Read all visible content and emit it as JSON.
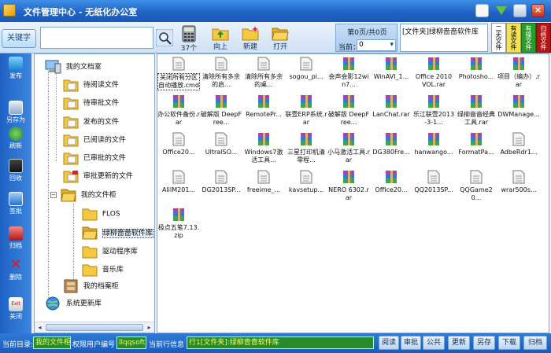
{
  "window": {
    "title": "文件管理中心 - 无纸化办公室"
  },
  "toolbar": {
    "keyword_label": "关键字",
    "search_value": "",
    "items": [
      {
        "label": "37个",
        "icon": "calculator-icon"
      },
      {
        "label": "向上",
        "icon": "folder-up-icon"
      },
      {
        "label": "新建",
        "icon": "new-folder-icon"
      },
      {
        "label": "打开",
        "icon": "open-folder-icon"
      }
    ],
    "page_info": "第0页/共0页",
    "current_label": "当前：",
    "current_page": "0",
    "path": "[文件夹]绿柳啬啬软件库",
    "tabs": [
      "二无文件",
      "有读文件",
      "有操文件",
      "归档文件"
    ]
  },
  "sidebar": {
    "items": [
      {
        "label": "发布",
        "icon": "publish-icon"
      },
      {
        "label": "另存为",
        "icon": "save-as-icon"
      },
      {
        "label": "刷新",
        "icon": "refresh-icon"
      },
      {
        "label": "回收",
        "icon": "recycle-icon"
      },
      {
        "label": "签批",
        "icon": "sign-icon"
      },
      {
        "label": "归档",
        "icon": "archive-icon"
      },
      {
        "label": "删除",
        "icon": "delete-icon"
      },
      {
        "label": "关闭",
        "icon": "exit-icon"
      }
    ]
  },
  "tree": {
    "root": "我的文档室",
    "children": [
      "待阅读文件",
      "待审批文件",
      "发布的文件",
      "已阅读的文件",
      "已审批的文件",
      "审批更新的文件"
    ],
    "cabinet": "我的文件柜",
    "cabinet_children": [
      "FLOS",
      "绿柳啬啬软件库",
      "驱动程序库",
      "音乐库"
    ],
    "archive": "我的档案柜",
    "update": "系统更新库"
  },
  "files": [
    {
      "name": "关闭所有分区自动播放.cmd",
      "type": "doc"
    },
    {
      "name": "清除所有多余的启...",
      "type": "doc"
    },
    {
      "name": "清除所有多余的桌...",
      "type": "doc"
    },
    {
      "name": "sogou_pi...",
      "type": "doc"
    },
    {
      "name": "会声会影12win7...",
      "type": "rar"
    },
    {
      "name": "WinAVI_1...",
      "type": "rar"
    },
    {
      "name": "Office 2010 VOL.rar",
      "type": "rar"
    },
    {
      "name": "Photosho...",
      "type": "rar"
    },
    {
      "name": "项目（编办）.rar",
      "type": "rar"
    },
    {
      "name": "办公软件备份.rar",
      "type": "rar"
    },
    {
      "name": "破解版 DeepFree...",
      "type": "rar"
    },
    {
      "name": "RemotePr...",
      "type": "rar"
    },
    {
      "name": "联壹ERP系统.rar",
      "type": "rar"
    },
    {
      "name": "破解版 DeepFree...",
      "type": "rar"
    },
    {
      "name": "LanChat.rar",
      "type": "rar"
    },
    {
      "name": "乐江联壹2013-3-1...",
      "type": "rar"
    },
    {
      "name": "绿柳啬啬经典工具.rar",
      "type": "rar"
    },
    {
      "name": "DWManage...",
      "type": "rar"
    },
    {
      "name": "Office20...",
      "type": "doc"
    },
    {
      "name": "UltraISO...",
      "type": "doc"
    },
    {
      "name": "Windows7激活工具...",
      "type": "rar"
    },
    {
      "name": "三星打印机清零程...",
      "type": "rar"
    },
    {
      "name": "小马激活工具.rar",
      "type": "rar"
    },
    {
      "name": "DG380Fre...",
      "type": "rar"
    },
    {
      "name": "hanwango...",
      "type": "rar"
    },
    {
      "name": "FormatPa...",
      "type": "rar"
    },
    {
      "name": "AdbeRdr1...",
      "type": "doc"
    },
    {
      "name": "AliIM201...",
      "type": "doc"
    },
    {
      "name": "DG2013SP...",
      "type": "doc"
    },
    {
      "name": "freeime_...",
      "type": "doc"
    },
    {
      "name": "kavsetup...",
      "type": "doc"
    },
    {
      "name": "NERO 6302.rar",
      "type": "rar"
    },
    {
      "name": "Office20...",
      "type": "rar"
    },
    {
      "name": "QQ2013SP...",
      "type": "doc"
    },
    {
      "name": "QQGame20...",
      "type": "doc"
    },
    {
      "name": "wrar500s...",
      "type": "doc"
    },
    {
      "name": "极点五笔7.13.zip",
      "type": "rar"
    }
  ],
  "statusbar": {
    "dir_label": "当前目录:",
    "dir_value": "我的文件柜",
    "user_label": "权限用户编号",
    "user_value": "llqqsoft",
    "row_label": "当前行信息",
    "row_value": "行1[文件夹]:绿柳啬啬软件库",
    "buttons": [
      "阅读",
      "审批",
      "公共",
      "更新",
      "另存",
      "下载",
      "归档"
    ]
  }
}
